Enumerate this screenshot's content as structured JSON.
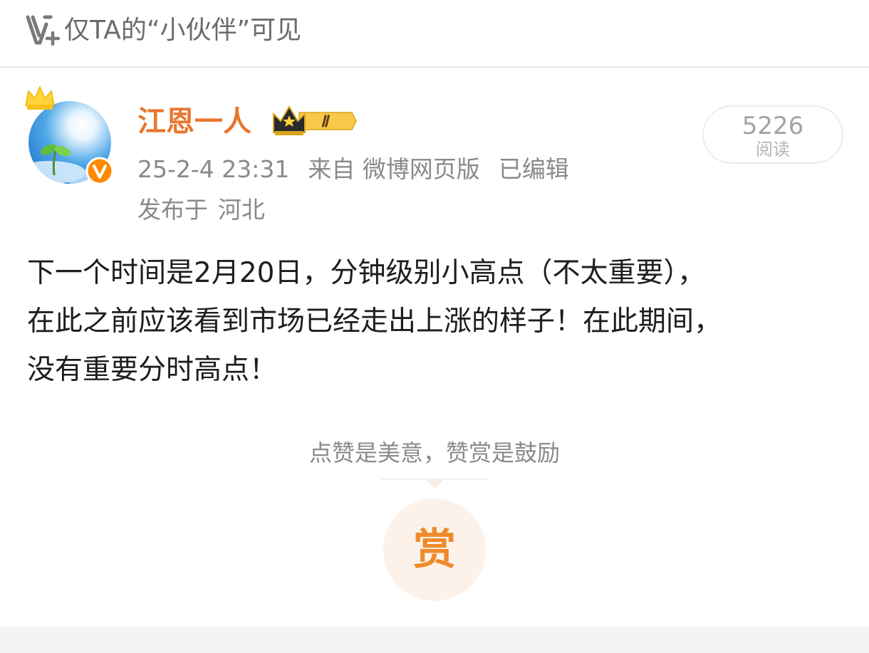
{
  "visibility": {
    "icon": "v-plus-icon",
    "text": "仅TA的“小伙伴”可见"
  },
  "author": {
    "name": "江恩一人",
    "avatar_icon": "sky-sprout-avatar",
    "crown_icon": "crown-icon",
    "verified_icon": "verified-v-icon",
    "vip_level": "Ⅱ",
    "name_color": "#e8762d"
  },
  "meta": {
    "timestamp": "25-2-4 23:31",
    "source": "来自 微博网页版",
    "edited": "已编辑",
    "location_prefix": "发布于",
    "location": "河北"
  },
  "stats": {
    "read_count": "5226",
    "read_label": "阅读"
  },
  "post": {
    "lines": [
      "下一个时间是2月20日，分钟级别小高点（不太重要），",
      "在此之前应该看到市场已经走出上涨的样子！在此期间，",
      "没有重要分时高点！"
    ]
  },
  "reward": {
    "hint": "点赞是美意，赞赏是鼓励",
    "button_label": "赏",
    "accent_color": "#ef8a2a"
  }
}
